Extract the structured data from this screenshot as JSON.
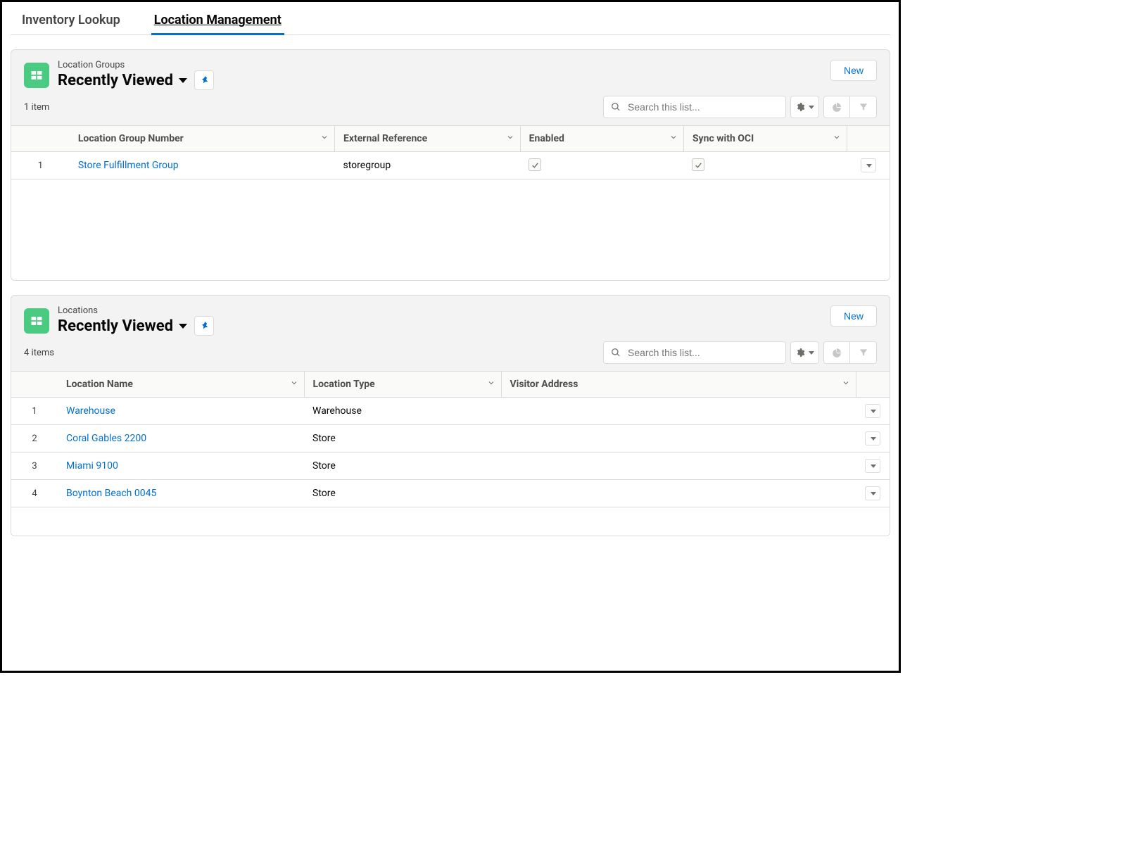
{
  "tabs": {
    "inventory": "Inventory Lookup",
    "location": "Location Management"
  },
  "common": {
    "view_name": "Recently Viewed",
    "new_label": "New",
    "search_placeholder": "Search this list..."
  },
  "panel_groups": {
    "object_label": "Location Groups",
    "item_count": "1 item",
    "columns": {
      "c1": "Location Group Number",
      "c2": "External Reference",
      "c3": "Enabled",
      "c4": "Sync with OCI"
    },
    "rows": [
      {
        "num": "1",
        "name": "Store Fulfillment Group",
        "ext": "storegroup",
        "enabled": true,
        "sync": true
      }
    ]
  },
  "panel_locations": {
    "object_label": "Locations",
    "item_count": "4 items",
    "columns": {
      "c1": "Location Name",
      "c2": "Location Type",
      "c3": "Visitor Address"
    },
    "rows": [
      {
        "num": "1",
        "name": "Warehouse",
        "type": "Warehouse",
        "addr": ""
      },
      {
        "num": "2",
        "name": "Coral Gables 2200",
        "type": "Store",
        "addr": ""
      },
      {
        "num": "3",
        "name": "Miami 9100",
        "type": "Store",
        "addr": ""
      },
      {
        "num": "4",
        "name": "Boynton Beach 0045",
        "type": "Store",
        "addr": ""
      }
    ]
  }
}
